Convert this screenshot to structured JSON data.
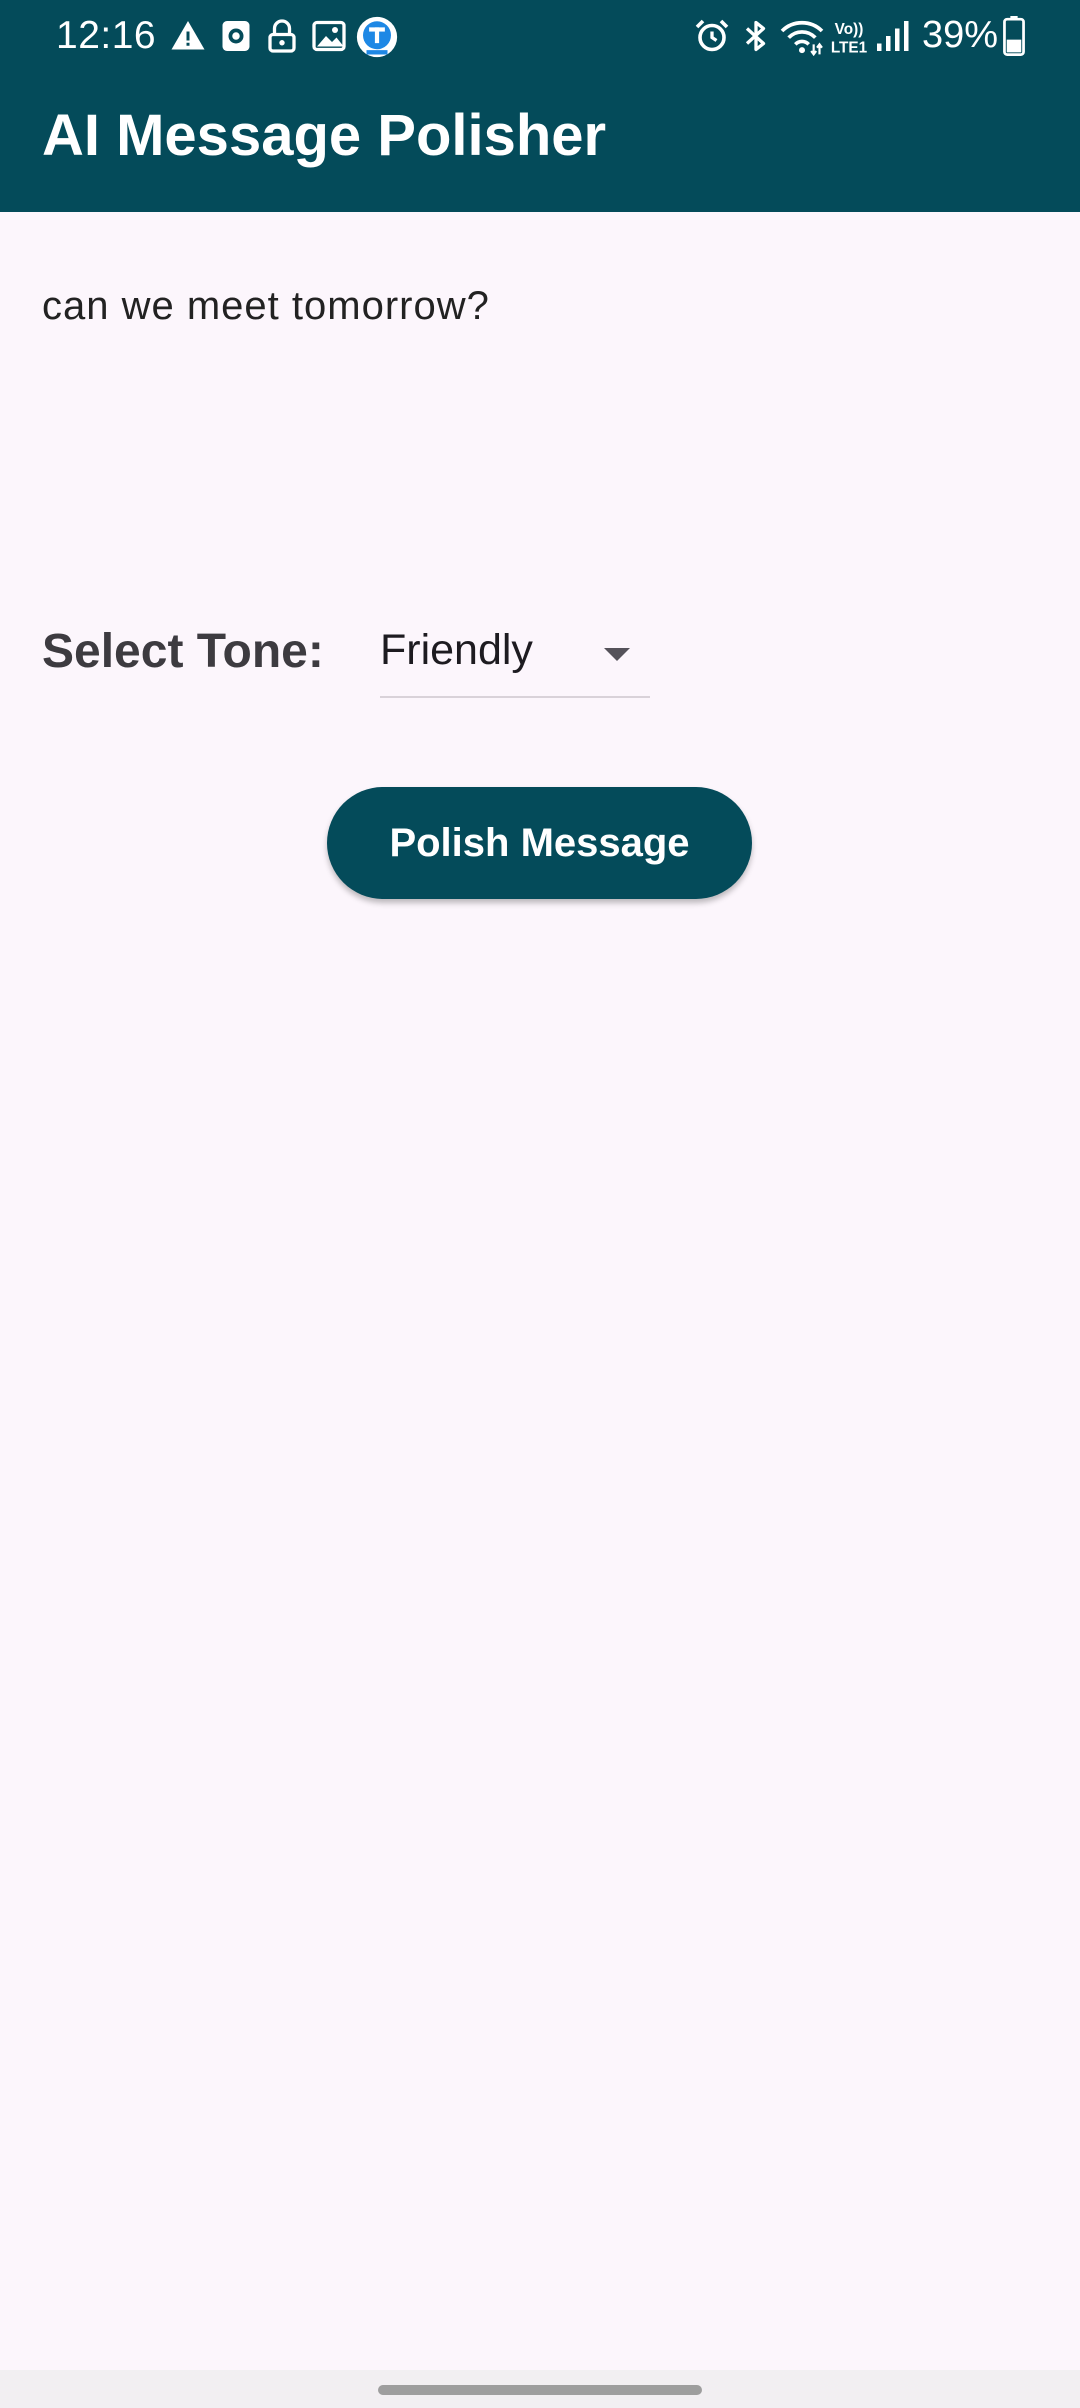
{
  "status_bar": {
    "time": "12:16",
    "battery": "39%",
    "left_icons": [
      "warning-icon",
      "screen-record-icon",
      "lock-icon",
      "gallery-icon",
      "app-notification-icon"
    ],
    "right_icons": [
      "alarm-icon",
      "bluetooth-icon",
      "wifi-icon",
      "volte-icon",
      "signal-icon",
      "battery-icon"
    ]
  },
  "app_bar": {
    "title": "AI Message Polisher"
  },
  "message": {
    "value": "can we meet tomorrow?"
  },
  "tone": {
    "label": "Select Tone:",
    "selected": "Friendly"
  },
  "actions": {
    "polish_label": "Polish Message"
  },
  "colors": {
    "primary": "#044b5a",
    "background": "#fcf6fc",
    "on_primary": "#ffffff"
  }
}
